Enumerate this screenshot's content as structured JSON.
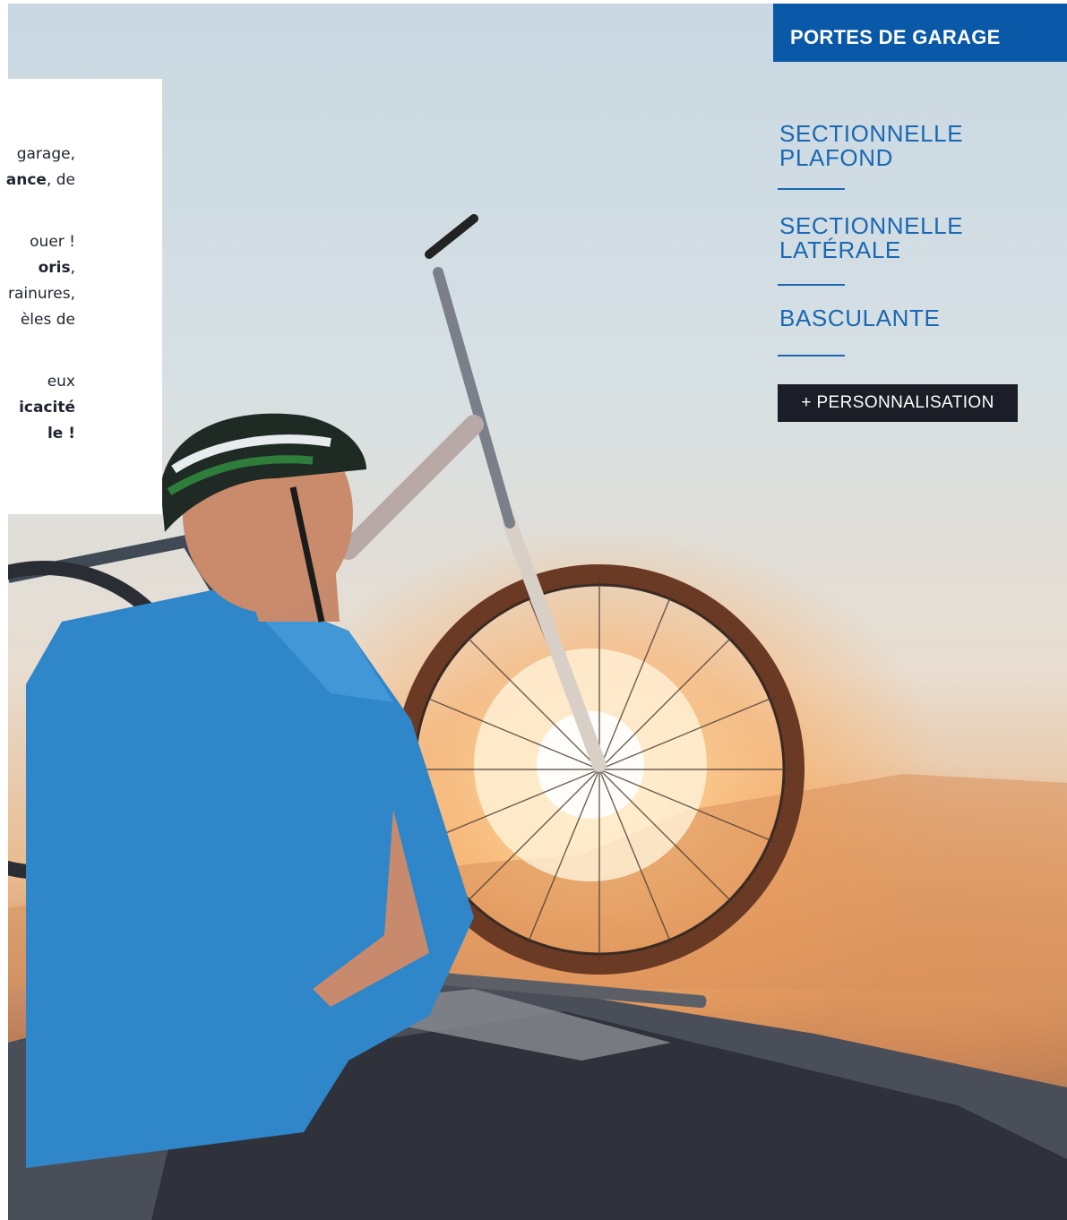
{
  "hero": {
    "image_alt": "Cycliste chargeant un VTT sur le toit d'une voiture au coucher du soleil"
  },
  "intro": {
    "paragraph1": [
      {
        "runs": [
          {
            "text": "garage,",
            "bold": false
          }
        ]
      },
      {
        "runs": [
          {
            "text": "ance",
            "bold": true
          },
          {
            "text": ", de",
            "bold": false
          }
        ]
      }
    ],
    "paragraph2": [
      {
        "runs": [
          {
            "text": "ouer !",
            "bold": false
          }
        ]
      },
      {
        "runs": [
          {
            "text": "oris",
            "bold": true
          },
          {
            "text": ",",
            "bold": false
          }
        ]
      },
      {
        "runs": [
          {
            "text": "rainures,",
            "bold": false
          }
        ]
      },
      {
        "runs": [
          {
            "text": "èles de",
            "bold": false
          }
        ]
      }
    ],
    "paragraph3": [
      {
        "runs": [
          {
            "text": "eux",
            "bold": false
          }
        ]
      },
      {
        "runs": [
          {
            "text": "icacité",
            "bold": true
          }
        ]
      },
      {
        "runs": [
          {
            "text": "le !",
            "bold": true
          }
        ]
      }
    ]
  },
  "panel": {
    "title": "PORTES DE GARAGE",
    "items": [
      {
        "line1": "SECTIONNELLE",
        "line2": "PLAFOND"
      },
      {
        "line1": "SECTIONNELLE",
        "line2": "LATÉRALE"
      },
      {
        "line1": "BASCULANTE",
        "line2": ""
      }
    ],
    "personalisation_label": "+ PERSONNALISATION"
  },
  "colors": {
    "brand_blue": "#0a58a8",
    "link_blue": "#1a68b3",
    "button_dark": "#1b1e26"
  }
}
